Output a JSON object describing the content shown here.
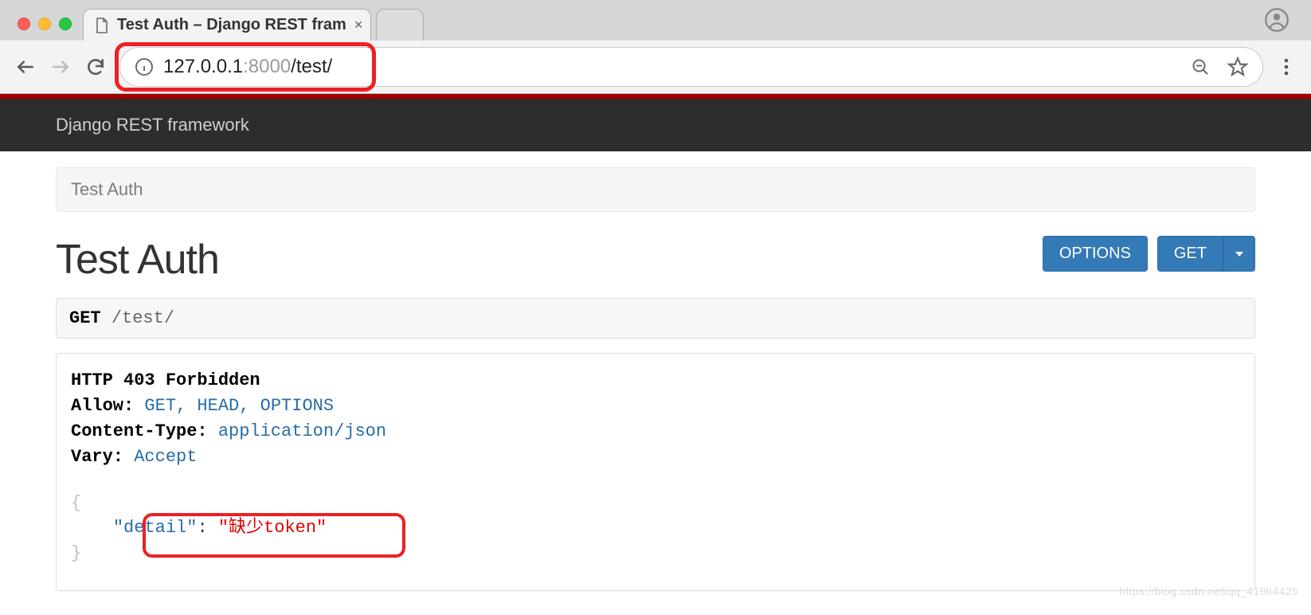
{
  "browser": {
    "tab_title": "Test Auth – Django REST fram",
    "url_display_host": "127.0.0.1",
    "url_display_port": ":8000",
    "url_display_path": "/test/"
  },
  "drf": {
    "brand": "Django REST framework",
    "breadcrumb": "Test Auth",
    "page_title": "Test Auth",
    "options_label": "OPTIONS",
    "get_label": "GET",
    "request": {
      "method": "GET",
      "path": "/test/"
    },
    "response": {
      "status_line": "HTTP 403 Forbidden",
      "headers": [
        {
          "k": "Allow:",
          "v": "GET, HEAD, OPTIONS"
        },
        {
          "k": "Content-Type:",
          "v": "application/json"
        },
        {
          "k": "Vary:",
          "v": "Accept"
        }
      ],
      "body_key": "\"detail\"",
      "body_value": "\"缺少token\""
    }
  },
  "watermark": "https://blog.csdn.net/qq_41964425"
}
